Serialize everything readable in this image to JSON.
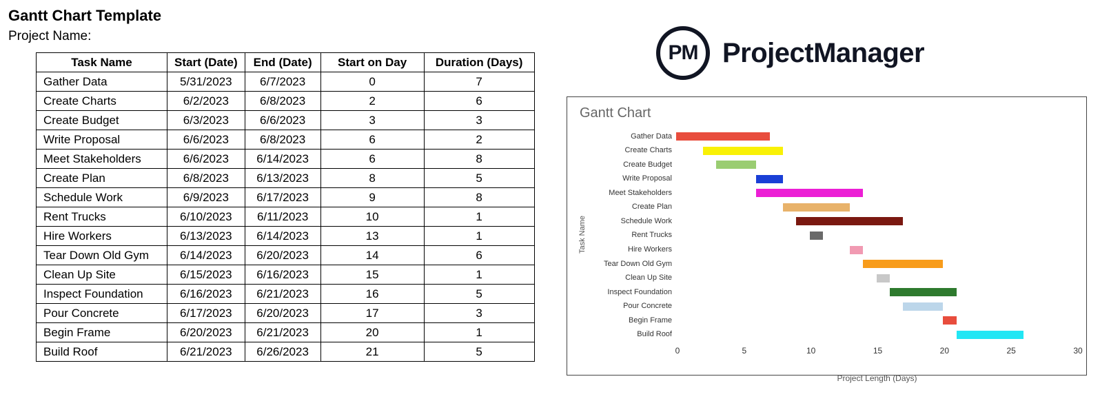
{
  "header": {
    "title": "Gantt Chart Template",
    "project_label": "Project Name:"
  },
  "logo": {
    "badge": "PM",
    "text": "ProjectManager"
  },
  "table": {
    "columns": [
      "Task Name",
      "Start (Date)",
      "End (Date)",
      "Start on Day",
      "Duration (Days)"
    ],
    "rows": [
      {
        "name": "Gather Data",
        "start": "5/31/2023",
        "end": "6/7/2023",
        "start_day": 0,
        "duration": 7
      },
      {
        "name": "Create Charts",
        "start": "6/2/2023",
        "end": "6/8/2023",
        "start_day": 2,
        "duration": 6
      },
      {
        "name": "Create Budget",
        "start": "6/3/2023",
        "end": "6/6/2023",
        "start_day": 3,
        "duration": 3
      },
      {
        "name": "Write Proposal",
        "start": "6/6/2023",
        "end": "6/8/2023",
        "start_day": 6,
        "duration": 2
      },
      {
        "name": "Meet Stakeholders",
        "start": "6/6/2023",
        "end": "6/14/2023",
        "start_day": 6,
        "duration": 8
      },
      {
        "name": "Create Plan",
        "start": "6/8/2023",
        "end": "6/13/2023",
        "start_day": 8,
        "duration": 5
      },
      {
        "name": "Schedule Work",
        "start": "6/9/2023",
        "end": "6/17/2023",
        "start_day": 9,
        "duration": 8
      },
      {
        "name": "Rent Trucks",
        "start": "6/10/2023",
        "end": "6/11/2023",
        "start_day": 10,
        "duration": 1
      },
      {
        "name": "Hire Workers",
        "start": "6/13/2023",
        "end": "6/14/2023",
        "start_day": 13,
        "duration": 1
      },
      {
        "name": "Tear Down Old Gym",
        "start": "6/14/2023",
        "end": "6/20/2023",
        "start_day": 14,
        "duration": 6
      },
      {
        "name": "Clean Up Site",
        "start": "6/15/2023",
        "end": "6/16/2023",
        "start_day": 15,
        "duration": 1
      },
      {
        "name": "Inspect Foundation",
        "start": "6/16/2023",
        "end": "6/21/2023",
        "start_day": 16,
        "duration": 5
      },
      {
        "name": "Pour Concrete",
        "start": "6/17/2023",
        "end": "6/20/2023",
        "start_day": 17,
        "duration": 3
      },
      {
        "name": "Begin Frame",
        "start": "6/20/2023",
        "end": "6/21/2023",
        "start_day": 20,
        "duration": 1
      },
      {
        "name": "Build Roof",
        "start": "6/21/2023",
        "end": "6/26/2023",
        "start_day": 21,
        "duration": 5
      }
    ]
  },
  "chart_data": {
    "type": "bar",
    "orientation": "horizontal-gantt",
    "title": "Gantt Chart",
    "ylabel": "Task Name",
    "xlabel": "Project Length (Days)",
    "xlim": [
      0,
      30
    ],
    "xticks": [
      0,
      5,
      10,
      15,
      20,
      25,
      30
    ],
    "categories": [
      "Gather Data",
      "Create Charts",
      "Create Budget",
      "Write Proposal",
      "Meet Stakeholders",
      "Create Plan",
      "Schedule Work",
      "Rent Trucks",
      "Hire Workers",
      "Tear Down Old Gym",
      "Clean Up Site",
      "Inspect Foundation",
      "Pour Concrete",
      "Begin Frame",
      "Build Roof"
    ],
    "series": [
      {
        "name": "Gather Data",
        "start": 0,
        "duration": 7,
        "color": "#e84d3d"
      },
      {
        "name": "Create Charts",
        "start": 2,
        "duration": 6,
        "color": "#f9f106"
      },
      {
        "name": "Create Budget",
        "start": 3,
        "duration": 3,
        "color": "#9acd72"
      },
      {
        "name": "Write Proposal",
        "start": 6,
        "duration": 2,
        "color": "#1a3fd6"
      },
      {
        "name": "Meet Stakeholders",
        "start": 6,
        "duration": 8,
        "color": "#ec1fd5"
      },
      {
        "name": "Create Plan",
        "start": 8,
        "duration": 5,
        "color": "#e8b26a"
      },
      {
        "name": "Schedule Work",
        "start": 9,
        "duration": 8,
        "color": "#7a1810"
      },
      {
        "name": "Rent Trucks",
        "start": 10,
        "duration": 1,
        "color": "#6a6a6a"
      },
      {
        "name": "Hire Workers",
        "start": 13,
        "duration": 1,
        "color": "#f19ab2"
      },
      {
        "name": "Tear Down Old Gym",
        "start": 14,
        "duration": 6,
        "color": "#f89c1b"
      },
      {
        "name": "Clean Up Site",
        "start": 15,
        "duration": 1,
        "color": "#c8c8c8"
      },
      {
        "name": "Inspect Foundation",
        "start": 16,
        "duration": 5,
        "color": "#2e7a2e"
      },
      {
        "name": "Pour Concrete",
        "start": 17,
        "duration": 3,
        "color": "#bcd6ea"
      },
      {
        "name": "Begin Frame",
        "start": 20,
        "duration": 1,
        "color": "#e84d3d"
      },
      {
        "name": "Build Roof",
        "start": 21,
        "duration": 5,
        "color": "#22e6f4"
      }
    ]
  }
}
